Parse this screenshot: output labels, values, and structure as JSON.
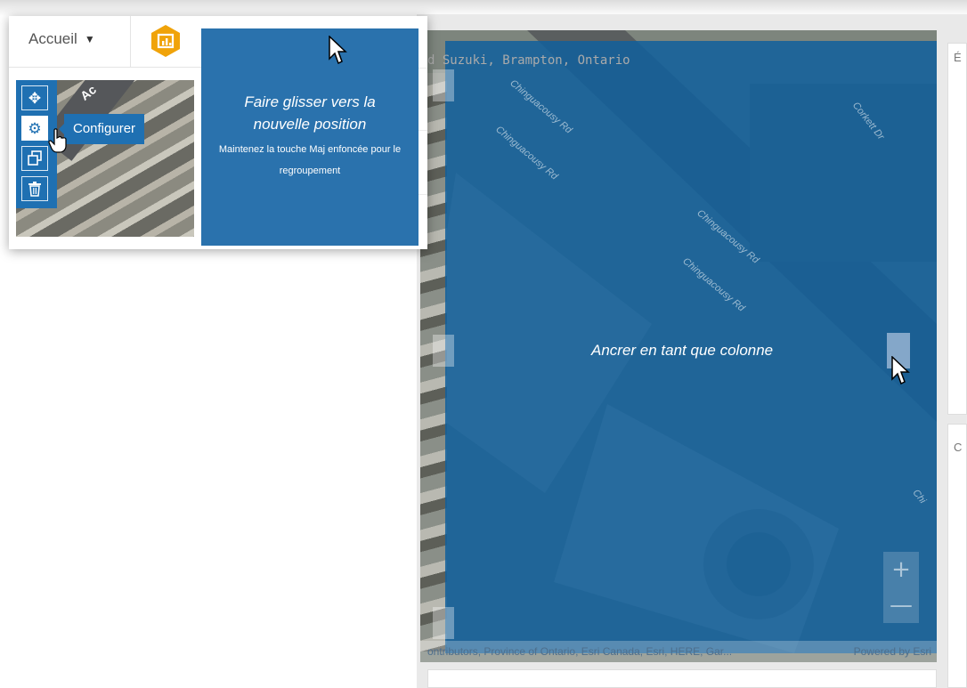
{
  "header": {
    "home_menu_label": "Accueil",
    "caret_icon": "caret-down-icon",
    "app_icon": "insights-app-icon",
    "app_icon_color": "#f0a30a"
  },
  "widget_tools": {
    "move_icon": "move-arrows-icon",
    "configure_icon": "gear-icon",
    "duplicate_icon": "duplicate-icon",
    "delete_icon": "trash-icon",
    "configure_tooltip": "Configurer"
  },
  "thumbnail": {
    "road_label": "Ac"
  },
  "drag_feedback": {
    "title": "Faire glisser vers la nouvelle position",
    "hint": "Maintenez la touche Maj enfoncée pour le regroupement"
  },
  "map_widget": {
    "title": "d Suzuki, Brampton, Ontario",
    "road_labels": [
      "Chinguacousy Rd",
      "Chinguacousy Rd",
      "Chinguacousy Rd",
      "Chinguacousy Rd",
      "Corkett Dr",
      "Chi"
    ],
    "dock_label": "Ancrer en tant que colonne",
    "zoom_in": "+",
    "zoom_out": "—",
    "attribution": "ontributors, Province of Ontario, Esri Canada, Esri, HERE, Gar...",
    "powered_by": "Powered by Esri"
  },
  "side_cards": {
    "top_label": "É",
    "bottom_label": "C"
  },
  "colors": {
    "accent": "#1f70b2",
    "dock_overlay": "#10609c",
    "drag_box": "#2a72ad"
  }
}
